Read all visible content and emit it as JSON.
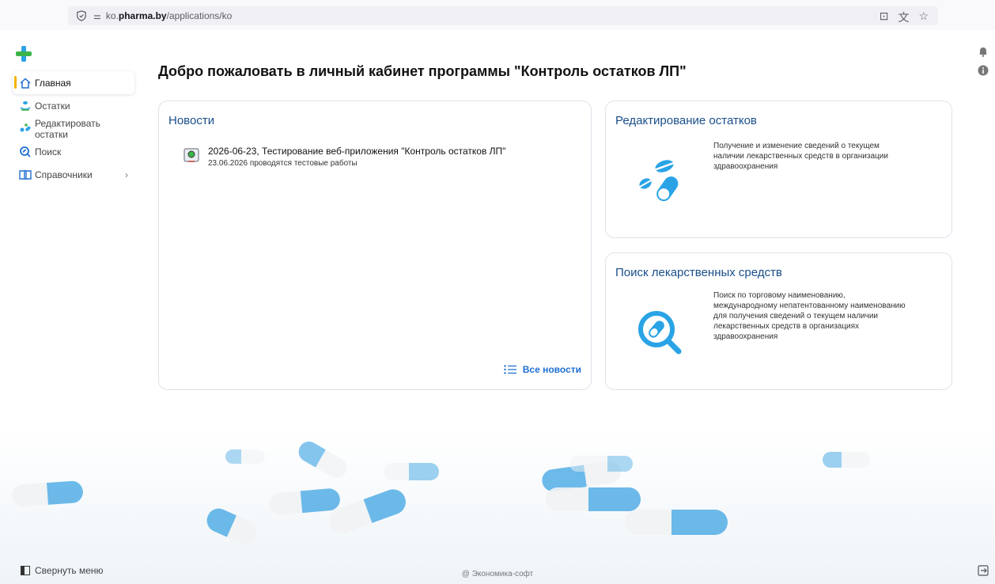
{
  "browser": {
    "url_prefix": "ko.",
    "url_domain": "pharma.by",
    "url_path": "/applications/ko"
  },
  "sidebar": {
    "items": [
      {
        "label": "Главная",
        "icon": "home-icon"
      },
      {
        "label": "Остатки",
        "icon": "stock-icon"
      },
      {
        "label": "Редактировать остатки",
        "icon": "edit-stock-icon"
      },
      {
        "label": "Поиск",
        "icon": "search-icon"
      },
      {
        "label": "Справочники",
        "icon": "book-icon"
      }
    ],
    "collapse_label": "Свернуть меню"
  },
  "main": {
    "welcome": "Добро пожаловать в личный кабинет программы \"Контроль остатков ЛП\"",
    "news": {
      "title": "Новости",
      "item_title": "2026-06-23, Тестирование веб-приложения \"Контроль остатков ЛП\"",
      "item_sub": "23.06.2026 проводятся тестовые работы",
      "all_label": "Все новости"
    },
    "edit_card": {
      "title": "Редактирование остатков",
      "desc": "Получение и изменение сведений о текущем наличии лекарственных средств в организации здравоохранения"
    },
    "search_card": {
      "title": "Поиск лекарственных средств",
      "desc": "Поиск по торговому наименованию, международному непатентованному наименованию для получения сведений о текущем наличии лекарственных средств в организациях здравоохранения"
    }
  },
  "footer": "@ Экономика-софт",
  "colors": {
    "accent": "#1e6fd0",
    "brand_green": "#3bb54a",
    "pill_blue": "#2aa3e6",
    "active_marker": "#f5b400"
  }
}
